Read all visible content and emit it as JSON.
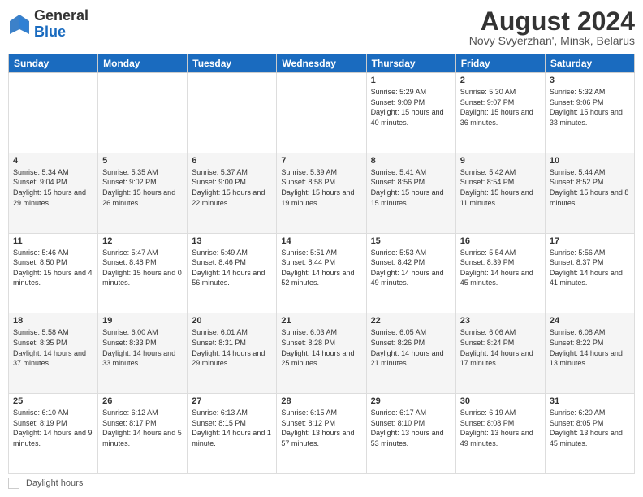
{
  "header": {
    "logo_general": "General",
    "logo_blue": "Blue",
    "month_title": "August 2024",
    "location": "Novy Svyerzhan', Minsk, Belarus"
  },
  "days_of_week": [
    "Sunday",
    "Monday",
    "Tuesday",
    "Wednesday",
    "Thursday",
    "Friday",
    "Saturday"
  ],
  "footer": {
    "daylight_label": "Daylight hours"
  },
  "weeks": [
    {
      "days": [
        {
          "num": "",
          "info": ""
        },
        {
          "num": "",
          "info": ""
        },
        {
          "num": "",
          "info": ""
        },
        {
          "num": "",
          "info": ""
        },
        {
          "num": "1",
          "info": "Sunrise: 5:29 AM\nSunset: 9:09 PM\nDaylight: 15 hours\nand 40 minutes."
        },
        {
          "num": "2",
          "info": "Sunrise: 5:30 AM\nSunset: 9:07 PM\nDaylight: 15 hours\nand 36 minutes."
        },
        {
          "num": "3",
          "info": "Sunrise: 5:32 AM\nSunset: 9:06 PM\nDaylight: 15 hours\nand 33 minutes."
        }
      ]
    },
    {
      "days": [
        {
          "num": "4",
          "info": "Sunrise: 5:34 AM\nSunset: 9:04 PM\nDaylight: 15 hours\nand 29 minutes."
        },
        {
          "num": "5",
          "info": "Sunrise: 5:35 AM\nSunset: 9:02 PM\nDaylight: 15 hours\nand 26 minutes."
        },
        {
          "num": "6",
          "info": "Sunrise: 5:37 AM\nSunset: 9:00 PM\nDaylight: 15 hours\nand 22 minutes."
        },
        {
          "num": "7",
          "info": "Sunrise: 5:39 AM\nSunset: 8:58 PM\nDaylight: 15 hours\nand 19 minutes."
        },
        {
          "num": "8",
          "info": "Sunrise: 5:41 AM\nSunset: 8:56 PM\nDaylight: 15 hours\nand 15 minutes."
        },
        {
          "num": "9",
          "info": "Sunrise: 5:42 AM\nSunset: 8:54 PM\nDaylight: 15 hours\nand 11 minutes."
        },
        {
          "num": "10",
          "info": "Sunrise: 5:44 AM\nSunset: 8:52 PM\nDaylight: 15 hours\nand 8 minutes."
        }
      ]
    },
    {
      "days": [
        {
          "num": "11",
          "info": "Sunrise: 5:46 AM\nSunset: 8:50 PM\nDaylight: 15 hours\nand 4 minutes."
        },
        {
          "num": "12",
          "info": "Sunrise: 5:47 AM\nSunset: 8:48 PM\nDaylight: 15 hours\nand 0 minutes."
        },
        {
          "num": "13",
          "info": "Sunrise: 5:49 AM\nSunset: 8:46 PM\nDaylight: 14 hours\nand 56 minutes."
        },
        {
          "num": "14",
          "info": "Sunrise: 5:51 AM\nSunset: 8:44 PM\nDaylight: 14 hours\nand 52 minutes."
        },
        {
          "num": "15",
          "info": "Sunrise: 5:53 AM\nSunset: 8:42 PM\nDaylight: 14 hours\nand 49 minutes."
        },
        {
          "num": "16",
          "info": "Sunrise: 5:54 AM\nSunset: 8:39 PM\nDaylight: 14 hours\nand 45 minutes."
        },
        {
          "num": "17",
          "info": "Sunrise: 5:56 AM\nSunset: 8:37 PM\nDaylight: 14 hours\nand 41 minutes."
        }
      ]
    },
    {
      "days": [
        {
          "num": "18",
          "info": "Sunrise: 5:58 AM\nSunset: 8:35 PM\nDaylight: 14 hours\nand 37 minutes."
        },
        {
          "num": "19",
          "info": "Sunrise: 6:00 AM\nSunset: 8:33 PM\nDaylight: 14 hours\nand 33 minutes."
        },
        {
          "num": "20",
          "info": "Sunrise: 6:01 AM\nSunset: 8:31 PM\nDaylight: 14 hours\nand 29 minutes."
        },
        {
          "num": "21",
          "info": "Sunrise: 6:03 AM\nSunset: 8:28 PM\nDaylight: 14 hours\nand 25 minutes."
        },
        {
          "num": "22",
          "info": "Sunrise: 6:05 AM\nSunset: 8:26 PM\nDaylight: 14 hours\nand 21 minutes."
        },
        {
          "num": "23",
          "info": "Sunrise: 6:06 AM\nSunset: 8:24 PM\nDaylight: 14 hours\nand 17 minutes."
        },
        {
          "num": "24",
          "info": "Sunrise: 6:08 AM\nSunset: 8:22 PM\nDaylight: 14 hours\nand 13 minutes."
        }
      ]
    },
    {
      "days": [
        {
          "num": "25",
          "info": "Sunrise: 6:10 AM\nSunset: 8:19 PM\nDaylight: 14 hours\nand 9 minutes."
        },
        {
          "num": "26",
          "info": "Sunrise: 6:12 AM\nSunset: 8:17 PM\nDaylight: 14 hours\nand 5 minutes."
        },
        {
          "num": "27",
          "info": "Sunrise: 6:13 AM\nSunset: 8:15 PM\nDaylight: 14 hours\nand 1 minute."
        },
        {
          "num": "28",
          "info": "Sunrise: 6:15 AM\nSunset: 8:12 PM\nDaylight: 13 hours\nand 57 minutes."
        },
        {
          "num": "29",
          "info": "Sunrise: 6:17 AM\nSunset: 8:10 PM\nDaylight: 13 hours\nand 53 minutes."
        },
        {
          "num": "30",
          "info": "Sunrise: 6:19 AM\nSunset: 8:08 PM\nDaylight: 13 hours\nand 49 minutes."
        },
        {
          "num": "31",
          "info": "Sunrise: 6:20 AM\nSunset: 8:05 PM\nDaylight: 13 hours\nand 45 minutes."
        }
      ]
    }
  ]
}
